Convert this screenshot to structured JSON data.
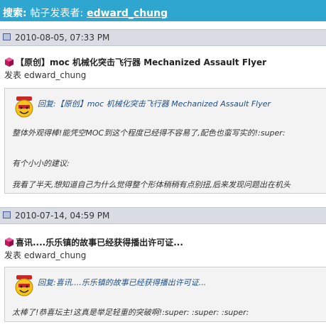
{
  "header": {
    "label": "搜索:",
    "sub": "帖子发表者:",
    "user": "edward_chung"
  },
  "posts": [
    {
      "date": "2010-08-05, 07:33 PM",
      "title": "【原创】moc 机械化突击飞行器  Mechanized Assault Flyer",
      "meta_label": "发表",
      "author": "edward_chung",
      "quote_title": "回复:【原创】moc 机械化突击飞行器  Mechanized Assault Flyer",
      "quote_lines": [
        "整体外观得棒!能凭空MOC到这个程度已经得不容易了,配色也蛮写实的!:super:",
        "有个小小的建议:",
        "我看了半天,想知道自己为什么觉得整个形体稍稍有点别扭,后来发现问题出在机头"
      ]
    },
    {
      "date": "2010-07-14, 04:59 PM",
      "title": "喜讯....乐乐镇的故事已经获得播出许可证...",
      "meta_label": "发表",
      "author": "edward_chung",
      "quote_title": "回复:喜讯....乐乐镇的故事已经获得播出许可证...",
      "quote_lines": [
        "太棒了!恭喜坛主!这真是举足轻重的突破啊!:super: :super: :super:"
      ]
    }
  ],
  "colors": {
    "header_bg": "#2fa6cf",
    "date_bar_bg": "#d9dde3",
    "quote_title": "#1c4f8a"
  },
  "icons": {
    "post": "lego-brick-icon",
    "quote": "smiley-face-icon",
    "date": "square-icon"
  }
}
